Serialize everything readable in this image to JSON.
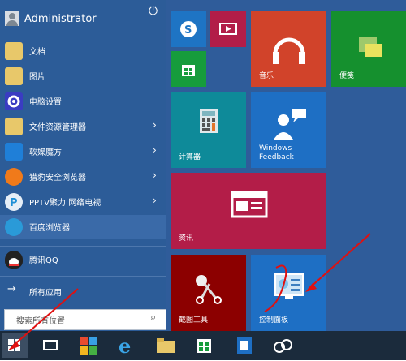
{
  "start_menu": {
    "user_name": "Administrator",
    "items": [
      {
        "label": "文档",
        "icon": "folder-icon",
        "has_arrow": false
      },
      {
        "label": "图片",
        "icon": "folder-icon",
        "has_arrow": false
      },
      {
        "label": "电脑设置",
        "icon": "gear-icon",
        "has_arrow": false
      },
      {
        "label": "文件资源管理器",
        "icon": "folder-icon",
        "has_arrow": true
      },
      {
        "label": "软媒魔方",
        "icon": "app-icon",
        "has_arrow": true
      },
      {
        "label": "猎豹安全浏览器",
        "icon": "browser-icon",
        "has_arrow": true
      },
      {
        "label": "PPTV聚力 网络电视",
        "icon": "pptv-icon",
        "has_arrow": true
      },
      {
        "label": "百度浏览器",
        "icon": "browser-icon",
        "has_arrow": false
      },
      {
        "label": "腾讯QQ",
        "icon": "qq-icon",
        "has_arrow": false
      }
    ],
    "all_apps": "所有应用",
    "search_placeholder": "搜索所有位置"
  },
  "tiles": {
    "music": "音乐",
    "sticky": "便笺",
    "calculator": "计算器",
    "feedback": "Windows Feedback",
    "news": "资讯",
    "snipping": "截图工具",
    "control_panel": "控制面板"
  },
  "colors": {
    "menu_bg": "#2f5c9a",
    "tile_red": "#c9432b",
    "tile_green": "#169c3c",
    "tile_teal": "#0e8a99",
    "tile_blue": "#1e6fc4",
    "tile_crimson": "#b31d48",
    "tile_darkred": "#8c0000",
    "taskbar": "#1b2b3c"
  }
}
